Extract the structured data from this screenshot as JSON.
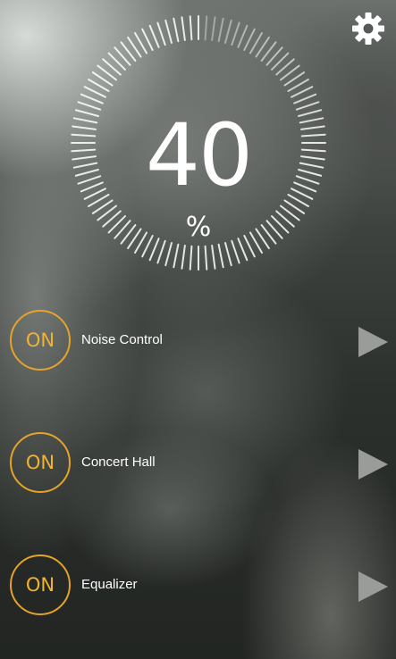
{
  "dial": {
    "value": "40",
    "unit": "%",
    "level_fraction": 0.0
  },
  "icons": {
    "settings": "gear-icon",
    "chevron": "play-arrow-icon"
  },
  "colors": {
    "accent": "#e6a32a",
    "text": "#ffffff",
    "arrow": "#9a9c9a"
  },
  "features": [
    {
      "badge": "ON",
      "label": "Noise Control"
    },
    {
      "badge": "ON",
      "label": "Concert Hall"
    },
    {
      "badge": "ON",
      "label": "Equalizer"
    }
  ]
}
